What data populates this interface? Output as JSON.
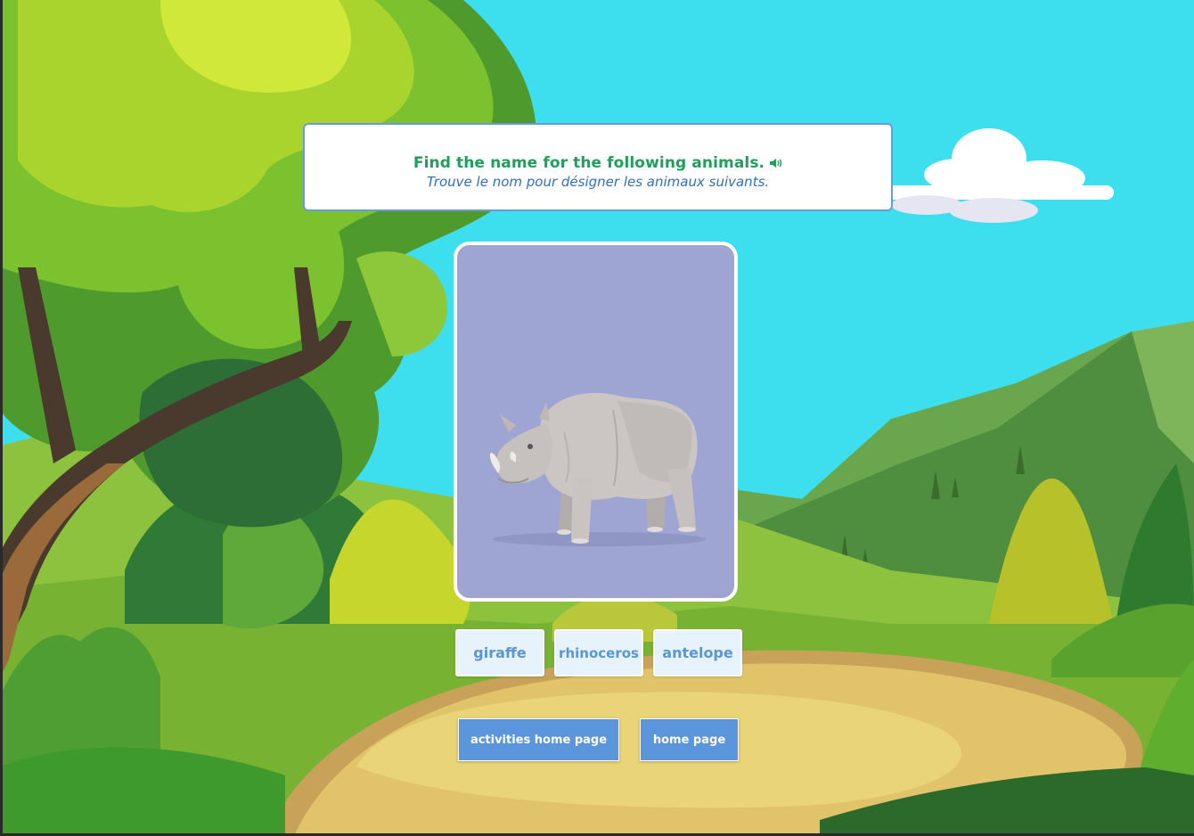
{
  "instruction": {
    "english": "Find the name for the following animals.",
    "french": "Trouve le nom pour désigner les animaux suivants.",
    "audio_icon": "speaker-icon"
  },
  "card": {
    "image": "rhinoceros-illustration",
    "background_color": "#9ea5d2"
  },
  "choices": [
    {
      "label": "giraffe"
    },
    {
      "label": "rhinoceros"
    },
    {
      "label": "antelope"
    }
  ],
  "navigation": {
    "activities_home": "activities home page",
    "home": "home page"
  },
  "colors": {
    "sky": "#3ddfee",
    "title_green": "#1fa05a",
    "subtitle_blue": "#2f6fc0",
    "choice_text": "#5b95d3",
    "button_blue": "#5b95dc"
  }
}
